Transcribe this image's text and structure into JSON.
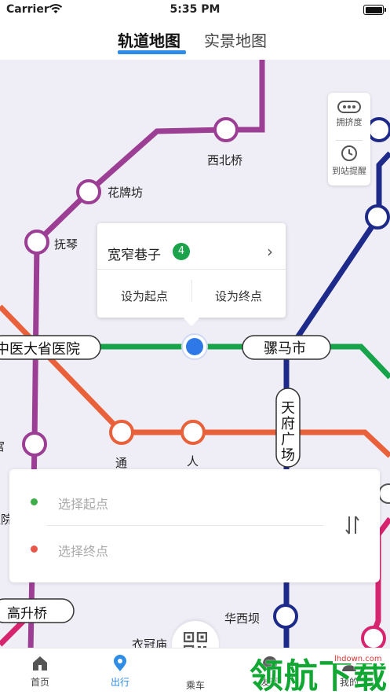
{
  "status_bar": {
    "carrier": "Carrier",
    "time": "5:35 PM"
  },
  "tabs": {
    "active": "轨道地图",
    "inactive": "实景地图"
  },
  "map": {
    "stations": {
      "xibeiqiao": "西北桥",
      "huapaifang": "花牌坊",
      "fuqin": "抚琴",
      "zhongyi": "中医大省医院",
      "luomashi": "骡马市",
      "tianfu": "天府广场",
      "tong": "通",
      "ren": "人",
      "gong": "宫",
      "yuan": "医院",
      "gaoshengqiao": "高升桥",
      "huaxiba": "华西坝",
      "yiguanmiao": "衣冠庙"
    },
    "line_colors": {
      "line2": "#e8613a",
      "line4": "#16a34a",
      "line1": "#1e2a8a",
      "line5": "#9b3e94",
      "line3": "#d6246e"
    }
  },
  "side_tools": {
    "crowd": "拥挤度",
    "alarm": "到站提醒"
  },
  "popup": {
    "station": "宽窄巷子",
    "line_no": "4",
    "set_start": "设为起点",
    "set_end": "设为终点"
  },
  "route": {
    "start_placeholder": "选择起点",
    "end_placeholder": "选择终点"
  },
  "bottom_nav": {
    "home": "首页",
    "travel": "出行",
    "ride": "乘车",
    "c4": "发现",
    "mine": "我的"
  },
  "watermark": {
    "brand": "领航下载",
    "url": "lhdown.com"
  }
}
